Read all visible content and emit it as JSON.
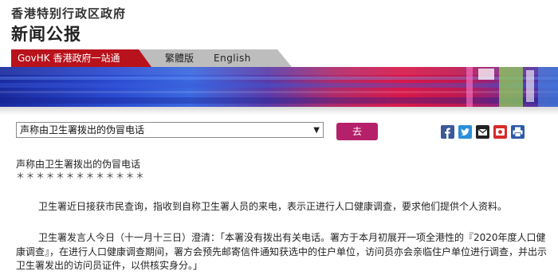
{
  "header": {
    "gov_name": "香港特别行政区政府",
    "section_title": "新闻公报"
  },
  "tabs": {
    "govhk_label": "GovHK 香港政府一站通",
    "traditional_label": "繁體版",
    "english_label": "English"
  },
  "toolbar": {
    "select_value": "声称由卫生署拨出的伪冒电话",
    "go_label": "去",
    "share_icons": [
      "facebook-icon",
      "twitter-icon",
      "email-icon",
      "weibo-icon",
      "print-icon"
    ]
  },
  "article": {
    "title": "声称由卫生署拨出的伪冒电话",
    "stars": "＊＊＊＊＊＊＊＊＊＊＊＊＊",
    "para1": "卫生署近日接获市民查询，指收到自称卫生署人员的来电，表示正进行人口健康调查，要求他们提供个人资料。",
    "para2": "卫生署发言人今日（十一月十三日）澄清：「本署没有拨出有关电话。署方于本月初展开一项全港性的『2020年度人口健康调查』，在进行人口健康调查期间，署方会预先邮寄信件通知获选中的住户单位，访问员亦会亲临住户单位进行调查，并出示卫生署发出的访问员证件，以供核实身分。」"
  },
  "colors": {
    "govhk_tab": "#b8121c",
    "go_button": "#b5206a",
    "facebook": "#3b5998",
    "twitter": "#1da1f2"
  }
}
